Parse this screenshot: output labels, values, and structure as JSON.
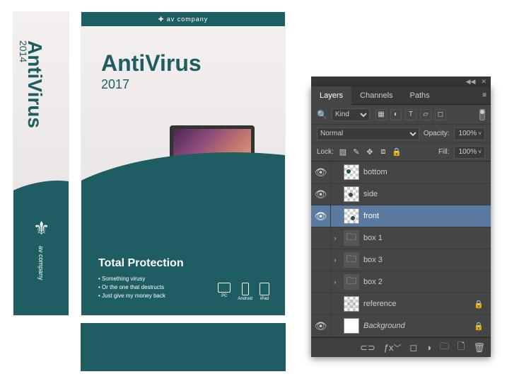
{
  "box": {
    "side": {
      "title": "AntiVirus",
      "year": "2014",
      "brand": "av company"
    },
    "front": {
      "header": "✚ av company",
      "title": "AntiVirus",
      "year": "2017",
      "protection_title": "Total Protection",
      "bullets": [
        "Something virusy",
        "Or the one that destructs",
        "Just give my money back"
      ],
      "devices": [
        "PC",
        "Android",
        "iPad"
      ]
    }
  },
  "panel": {
    "tabs": [
      "Layers",
      "Channels",
      "Paths"
    ],
    "kind_label": "Kind",
    "blend_mode": "Normal",
    "opacity_label": "Opacity:",
    "opacity_value": "100%",
    "lock_label": "Lock:",
    "fill_label": "Fill:",
    "fill_value": "100%",
    "layers": [
      {
        "name": "bottom",
        "visible": true,
        "type": "smart",
        "indent": 0,
        "selected": false
      },
      {
        "name": "side",
        "visible": true,
        "type": "smart",
        "indent": 0,
        "selected": false
      },
      {
        "name": "front",
        "visible": true,
        "type": "smart",
        "indent": 0,
        "selected": true
      },
      {
        "name": "box 1",
        "visible": false,
        "type": "folder",
        "indent": 0,
        "selected": false,
        "expandable": true
      },
      {
        "name": "box 3",
        "visible": false,
        "type": "folder",
        "indent": 0,
        "selected": false,
        "expandable": true
      },
      {
        "name": "box 2",
        "visible": false,
        "type": "folder",
        "indent": 0,
        "selected": false,
        "expandable": true
      },
      {
        "name": "reference",
        "visible": false,
        "type": "layer",
        "indent": 0,
        "selected": false,
        "locked": true
      },
      {
        "name": "Background",
        "visible": true,
        "type": "bg",
        "indent": 0,
        "selected": false,
        "locked": true,
        "italic": true
      }
    ]
  }
}
